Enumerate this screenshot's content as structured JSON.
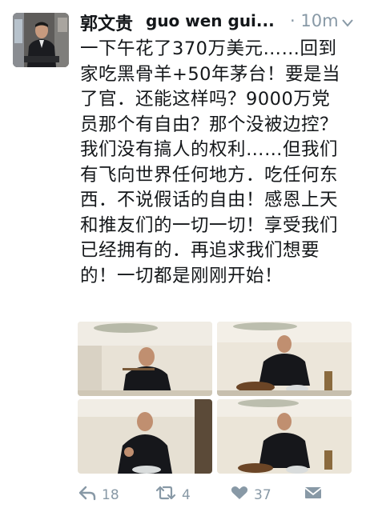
{
  "tweet": {
    "author_name": "郭文贵",
    "author_handle": "guo wen gui...",
    "time": "· 10m",
    "text_lines": [
      "一下午花了370万美元……回到",
      "家吃黑骨羊+50年茅台！要是当",
      "了官．还能这样吗？9000万党",
      "员那个有自由？那个没被边控？",
      "我们没有搞人的权利……但我们",
      "有飞向世界任何地方．吃任何东",
      "西．不说假话的自由！感恩上天",
      "和推友们的一切一切！享受我们",
      "已经拥有的．再追求我们想要",
      "的！一切都是刚刚开始！"
    ]
  },
  "actions": {
    "reply_count": "18",
    "retweet_count": "4",
    "like_count": "37"
  },
  "icons": {
    "reply": "reply-icon",
    "retweet": "retweet-icon",
    "like": "heart-icon",
    "dm": "envelope-icon",
    "menu": "chevron-down-icon"
  },
  "colors": {
    "text": "#14171a",
    "secondary": "#8899a6"
  }
}
